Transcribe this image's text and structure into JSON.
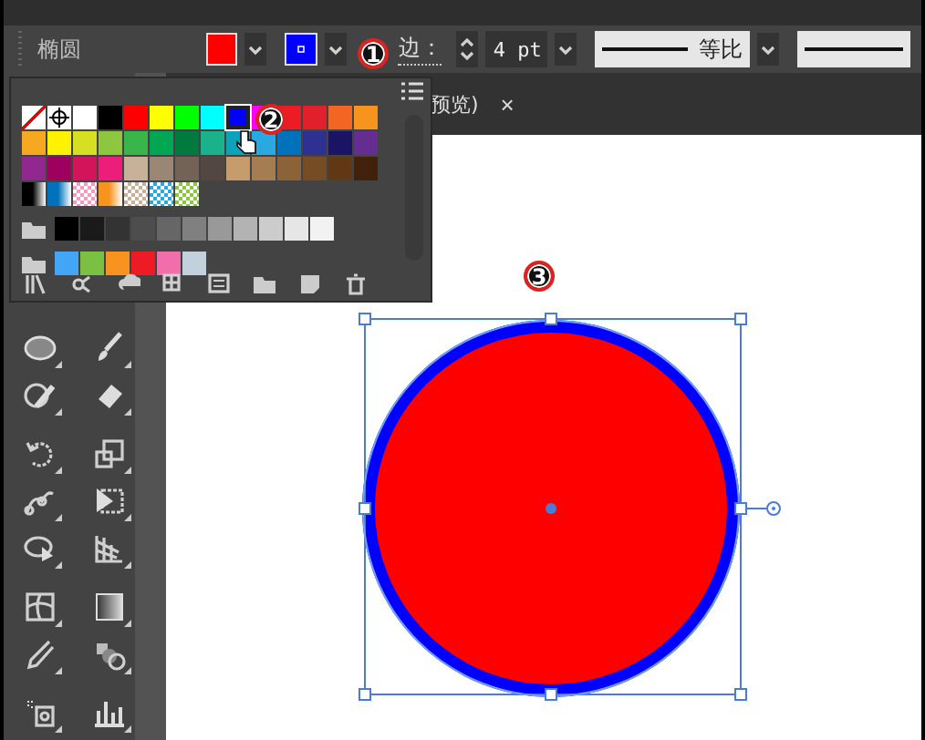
{
  "toolbar": {
    "tool_name": "椭圆",
    "fill": {
      "color": "#ff0000"
    },
    "stroke": {
      "color": "#0000ff"
    },
    "stroke_label": "边：",
    "stroke_weight": "4 pt",
    "profile_label": "等比"
  },
  "document_tab": {
    "title": "预览)",
    "close": "×"
  },
  "swatches": {
    "rows": [
      [
        {
          "kind": "none",
          "color": "#ffffff",
          "selected": false
        },
        {
          "kind": "registration",
          "color": "#ffffff",
          "selected": false
        },
        {
          "kind": "solid",
          "color": "#ffffff",
          "selected": false
        },
        {
          "kind": "solid",
          "color": "#000000",
          "selected": false
        },
        {
          "kind": "solid",
          "color": "#ff0000",
          "selected": false
        },
        {
          "kind": "solid",
          "color": "#ffff00",
          "selected": false
        },
        {
          "kind": "solid",
          "color": "#00ff00",
          "selected": false
        },
        {
          "kind": "solid",
          "color": "#00ffff",
          "selected": false
        },
        {
          "kind": "solid",
          "color": "#0000ff",
          "selected": true
        },
        {
          "kind": "solid",
          "color": "#ff00ff",
          "selected": false
        },
        {
          "kind": "solid",
          "color": "#ed1c24",
          "selected": false
        },
        {
          "kind": "solid",
          "color": "#e0202a",
          "selected": false
        },
        {
          "kind": "solid",
          "color": "#f26522",
          "selected": false
        },
        {
          "kind": "solid",
          "color": "#f7941d",
          "selected": false
        }
      ],
      [
        {
          "kind": "solid",
          "color": "#f7a823",
          "selected": false
        },
        {
          "kind": "solid",
          "color": "#fff200",
          "selected": false
        },
        {
          "kind": "solid",
          "color": "#d7df23",
          "selected": false
        },
        {
          "kind": "solid",
          "color": "#8dc63f",
          "selected": false
        },
        {
          "kind": "solid",
          "color": "#39b54a",
          "selected": false
        },
        {
          "kind": "solid",
          "color": "#00a651",
          "selected": false
        },
        {
          "kind": "solid",
          "color": "#007a3d",
          "selected": false
        },
        {
          "kind": "solid",
          "color": "#1ab28a",
          "selected": false
        },
        {
          "kind": "solid",
          "color": "#0ca3b8",
          "selected": false
        },
        {
          "kind": "solid",
          "color": "#29a9e0",
          "selected": false
        },
        {
          "kind": "solid",
          "color": "#0072bc",
          "selected": false
        },
        {
          "kind": "solid",
          "color": "#2e3192",
          "selected": false
        },
        {
          "kind": "solid",
          "color": "#1b1464",
          "selected": false
        },
        {
          "kind": "solid",
          "color": "#662d91",
          "selected": false
        }
      ],
      [
        {
          "kind": "solid",
          "color": "#92278f",
          "selected": false
        },
        {
          "kind": "solid",
          "color": "#9e005d",
          "selected": false
        },
        {
          "kind": "solid",
          "color": "#d4145a",
          "selected": false
        },
        {
          "kind": "solid",
          "color": "#ed1e79",
          "selected": false
        },
        {
          "kind": "solid",
          "color": "#c7b299",
          "selected": false
        },
        {
          "kind": "solid",
          "color": "#998675",
          "selected": false
        },
        {
          "kind": "solid",
          "color": "#736357",
          "selected": false
        },
        {
          "kind": "solid",
          "color": "#534741",
          "selected": false
        },
        {
          "kind": "solid",
          "color": "#c69c6d",
          "selected": false
        },
        {
          "kind": "solid",
          "color": "#a67c52",
          "selected": false
        },
        {
          "kind": "solid",
          "color": "#8c6239",
          "selected": false
        },
        {
          "kind": "solid",
          "color": "#754c24",
          "selected": false
        },
        {
          "kind": "solid",
          "color": "#603813",
          "selected": false
        },
        {
          "kind": "solid",
          "color": "#42210b",
          "selected": false
        }
      ],
      [
        {
          "kind": "gradient",
          "color": "#000000",
          "selected": false
        },
        {
          "kind": "gradient",
          "color": "#0072bc",
          "selected": false
        },
        {
          "kind": "pattern",
          "color": "#f49ac1",
          "selected": false
        },
        {
          "kind": "gradient",
          "color": "#f7941d",
          "selected": false
        },
        {
          "kind": "pattern",
          "color": "#c7b299",
          "selected": false
        },
        {
          "kind": "pattern",
          "color": "#29a9e0",
          "selected": false
        },
        {
          "kind": "pattern",
          "color": "#8dc63f",
          "selected": false
        }
      ],
      [
        {
          "kind": "folder",
          "color": "#cccccc",
          "selected": false
        },
        {
          "kind": "solid",
          "color": "#000000",
          "selected": false
        },
        {
          "kind": "solid",
          "color": "#1a1a1a",
          "selected": false
        },
        {
          "kind": "solid",
          "color": "#333333",
          "selected": false
        },
        {
          "kind": "solid",
          "color": "#4d4d4d",
          "selected": false
        },
        {
          "kind": "solid",
          "color": "#666666",
          "selected": false
        },
        {
          "kind": "solid",
          "color": "#808080",
          "selected": false
        },
        {
          "kind": "solid",
          "color": "#999999",
          "selected": false
        },
        {
          "kind": "solid",
          "color": "#b3b3b3",
          "selected": false
        },
        {
          "kind": "solid",
          "color": "#cccccc",
          "selected": false
        },
        {
          "kind": "solid",
          "color": "#e6e6e6",
          "selected": false
        },
        {
          "kind": "solid",
          "color": "#f2f2f2",
          "selected": false
        }
      ],
      [
        {
          "kind": "folder",
          "color": "#cccccc",
          "selected": false
        },
        {
          "kind": "solid",
          "color": "#42a5f5",
          "selected": false
        },
        {
          "kind": "solid",
          "color": "#7ac143",
          "selected": false
        },
        {
          "kind": "solid",
          "color": "#f7931e",
          "selected": false
        },
        {
          "kind": "solid",
          "color": "#ed1c24",
          "selected": false
        },
        {
          "kind": "solid",
          "color": "#f06eaa",
          "selected": false
        },
        {
          "kind": "solid",
          "color": "#c2d1dc",
          "selected": false
        }
      ]
    ]
  },
  "annotations": [
    {
      "label": "1"
    },
    {
      "label": "2"
    },
    {
      "label": "3"
    }
  ],
  "artwork": {
    "selected": true
  }
}
